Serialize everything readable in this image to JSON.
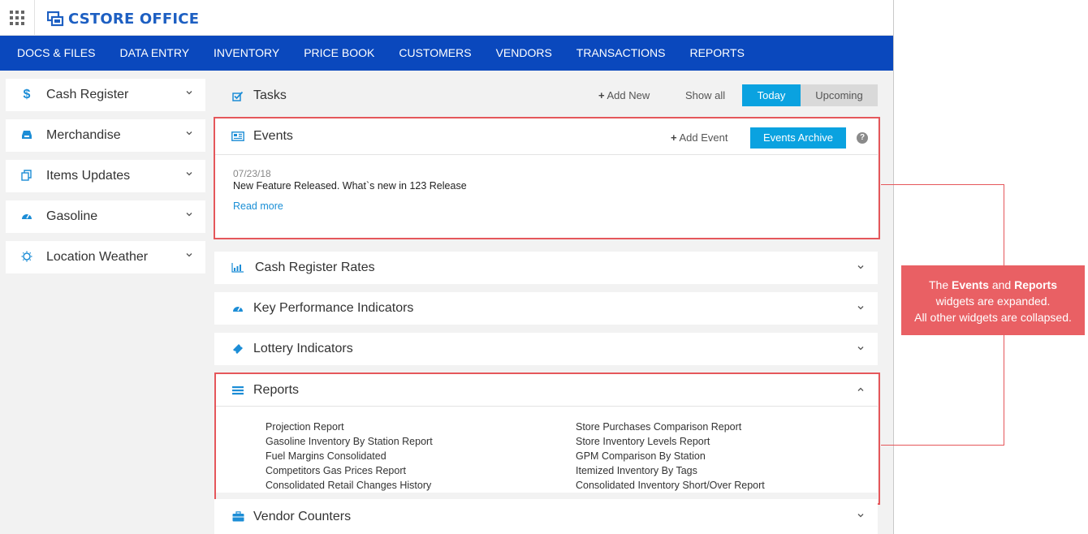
{
  "app": {
    "logo_text": "CSTORE OFFICE",
    "accent_color": "#0a48bd",
    "button_color": "#0aa2e0",
    "highlight_color": "#e5575b"
  },
  "nav": {
    "items": [
      "DOCS & FILES",
      "DATA ENTRY",
      "INVENTORY",
      "PRICE BOOK",
      "CUSTOMERS",
      "VENDORS",
      "TRANSACTIONS",
      "REPORTS"
    ]
  },
  "sidebar": {
    "items": [
      {
        "label": "Cash Register",
        "icon": "dollar-icon"
      },
      {
        "label": "Merchandise",
        "icon": "inbox-icon"
      },
      {
        "label": "Items Updates",
        "icon": "copy-icon"
      },
      {
        "label": "Gasoline",
        "icon": "gauge-icon"
      },
      {
        "label": "Location Weather",
        "icon": "sun-icon"
      }
    ]
  },
  "tasks": {
    "title": "Tasks",
    "add_new": "Add New",
    "show_all": "Show all",
    "today": "Today",
    "upcoming": "Upcoming"
  },
  "events": {
    "title": "Events",
    "add_event": "Add Event",
    "archive": "Events Archive",
    "help": "?",
    "item": {
      "date": "07/23/18",
      "title": "New Feature Released. What`s new in 123 Release",
      "read_more": "Read more"
    }
  },
  "widgets": {
    "cash_register_rates": "Cash Register Rates",
    "kpi": "Key Performance Indicators",
    "lottery": "Lottery Indicators",
    "vendor_counters": "Vendor Counters"
  },
  "reports": {
    "title": "Reports",
    "left": [
      "Projection Report",
      "Gasoline Inventory By Station Report",
      "Fuel Margins Consolidated",
      "Competitors Gas Prices Report",
      "Consolidated Retail Changes History"
    ],
    "right": [
      "Store Purchases Comparison Report",
      "Store Inventory Levels Report",
      "GPM Comparison By Station",
      "Itemized Inventory By Tags",
      "Consolidated Inventory Short/Over Report"
    ]
  },
  "annotation": {
    "the": "The",
    "events": "Events",
    "and": "and",
    "reports": "Reports",
    "line2": "widgets are expanded.",
    "line3": "All other widgets are collapsed."
  }
}
